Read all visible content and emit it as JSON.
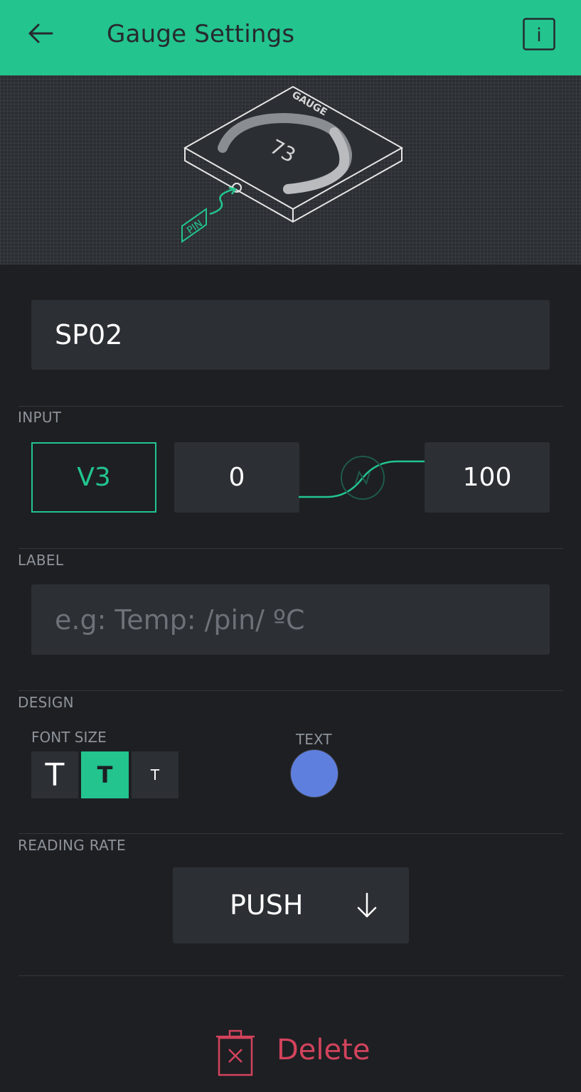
{
  "header": {
    "title": "Gauge Settings",
    "back_icon": "arrow-left-icon",
    "info_icon": "info-icon",
    "info_label": "i",
    "accent_color": "#23c48e"
  },
  "preview": {
    "gauge_caption": "GAUGE",
    "gauge_value": "73",
    "pin_caption": "PIN"
  },
  "widget_name": {
    "value": "SP02"
  },
  "input_section": {
    "label": "INPUT",
    "pin": "V3",
    "min": "0",
    "max": "100"
  },
  "label_section": {
    "label": "LABEL",
    "placeholder": "e.g: Temp: /pin/ ºC"
  },
  "design_section": {
    "label": "DESIGN",
    "font_size_label": "FONT SIZE",
    "font_sizes": [
      {
        "label": "T",
        "size": "large"
      },
      {
        "label": "T",
        "size": "medium",
        "selected": true
      },
      {
        "label": "T",
        "size": "small"
      }
    ],
    "text_color_label": "TEXT",
    "text_color": "#5f7fdf"
  },
  "reading_rate": {
    "label": "READING RATE",
    "value": "PUSH",
    "icon": "arrow-down-icon"
  },
  "delete": {
    "label": "Delete",
    "icon": "trash-icon",
    "color": "#d3435c"
  }
}
